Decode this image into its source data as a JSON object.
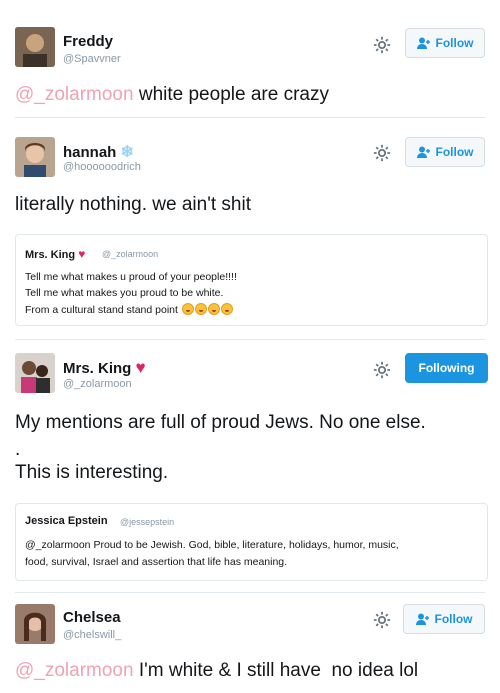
{
  "tweets": [
    {
      "name": "Freddy",
      "handle": "@Spavvner",
      "button": "Follow",
      "mention": "@_zolarmoon",
      "text": " white people are crazy"
    },
    {
      "name": "hannah",
      "name_icon": "snowflake-icon",
      "handle": "@hoooooodrich",
      "button": "Follow",
      "text": "literally nothing. we ain't shit",
      "quote": {
        "name": "Mrs. King",
        "name_icon": "heart-icon",
        "handle": "@_zolarmoon",
        "lines": [
          "Tell me what makes u proud of your people!!!!",
          "Tell me what makes you proud to be white.",
          "From a cultural stand stand point"
        ],
        "emoji": "kissing-face-icon"
      }
    },
    {
      "name": "Mrs. King",
      "name_icon": "heart-icon",
      "handle": "@_zolarmoon",
      "button": "Following",
      "lines": [
        "My mentions are full of proud Jews. No one else.",
        ".",
        "This is interesting."
      ],
      "quote": {
        "name": "Jessica Epstein",
        "handle": "@jessepstein",
        "lines": [
          "@_zolarmoon Proud to be Jewish. God, bible, literature, holidays, humor, music,",
          "food, survival, Israel and assertion that life has meaning."
        ]
      }
    },
    {
      "name": "Chelsea",
      "handle": "@chelswill_",
      "button": "Follow",
      "mention": "@_zolarmoon",
      "text": " I'm white & I still have  no idea lol"
    }
  ],
  "colors": {
    "accent": "#1b95e0",
    "mention": "#f0a3b4",
    "heart": "#e0245e",
    "handle": "#8899a6"
  }
}
